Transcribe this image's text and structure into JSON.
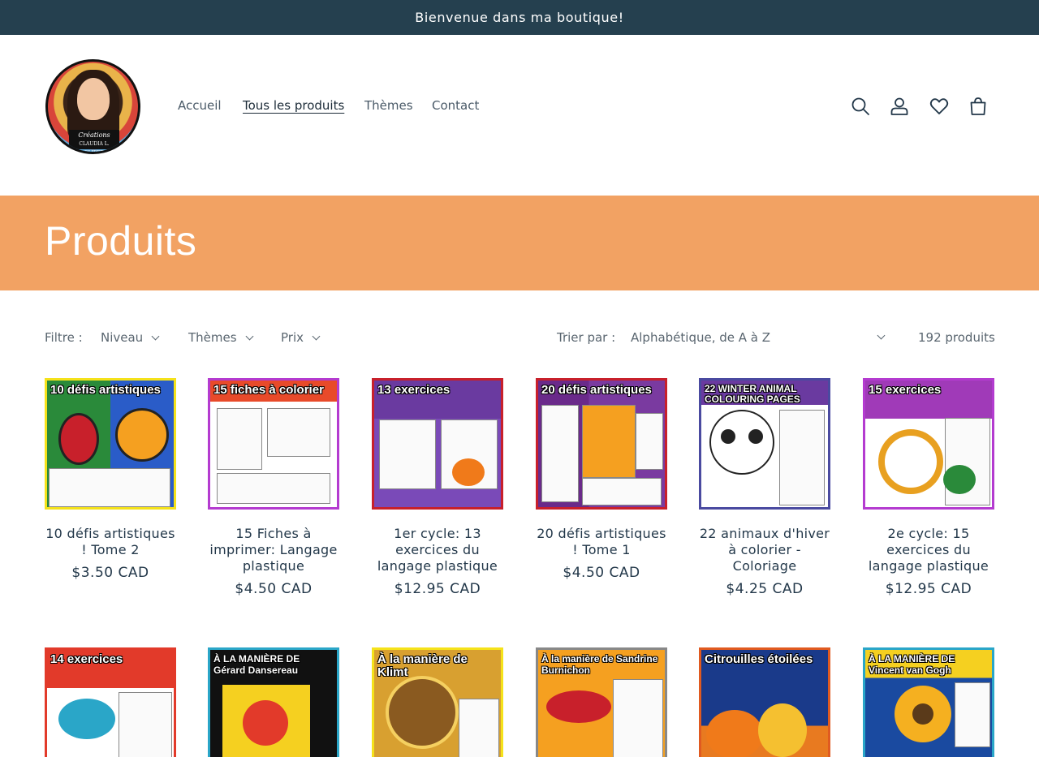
{
  "announcement": "Bienvenue dans ma boutique!",
  "logo": {
    "text_line1": "Créations",
    "text_line2": "CLAUDIA L. OLIBER"
  },
  "nav": [
    {
      "label": "Accueil",
      "active": false
    },
    {
      "label": "Tous les produits",
      "active": true
    },
    {
      "label": "Thèmes",
      "active": false
    },
    {
      "label": "Contact",
      "active": false
    }
  ],
  "header_icons": [
    "search-icon",
    "account-icon",
    "wishlist-heart-icon",
    "cart-icon"
  ],
  "colors": {
    "announcement_bg": "#25404f",
    "banner_bg": "#f2a263",
    "text": "#23384a"
  },
  "banner": {
    "title": "Produits"
  },
  "filters": {
    "label": "Filtre :",
    "items": [
      "Niveau",
      "Thèmes",
      "Prix"
    ],
    "sort_label": "Trier par :",
    "sort_value": "Alphabétique, de A à Z",
    "count": "192 produits"
  },
  "products": [
    {
      "name": "10 défis artistiques ! Tome 2",
      "price": "$3.50 CAD",
      "thumb_title": "10 défis artistiques",
      "border": "#f5e21a"
    },
    {
      "name": "15 Fiches à imprimer: Langage plastique",
      "price": "$4.50 CAD",
      "thumb_title": "15 fiches à colorier",
      "border": "#b43bd0"
    },
    {
      "name": "1er cycle: 13 exercices du langage plastique",
      "price": "$12.95 CAD",
      "thumb_title": "13 exercices",
      "border": "#c8202b"
    },
    {
      "name": "20 défis artistiques ! Tome 1",
      "price": "$4.50 CAD",
      "thumb_title": "20 défis artistiques",
      "border": "#c8202b"
    },
    {
      "name": "22 animaux d'hiver à colorier - Coloriage",
      "price": "$4.25 CAD",
      "thumb_title": "22 WINTER ANIMAL COLOURING PAGES",
      "border": "#4a4aa0"
    },
    {
      "name": "2e cycle: 15 exercices du langage plastique",
      "price": "$12.95 CAD",
      "thumb_title": "15 exercices",
      "border": "#b43bd0"
    },
    {
      "name": "",
      "price": "",
      "thumb_title": "14 exercices",
      "border": "#e23a2a"
    },
    {
      "name": "",
      "price": "",
      "thumb_title": "À LA MANIÈRE DE Gérard Dansereau",
      "border": "#2aa6c8"
    },
    {
      "name": "",
      "price": "",
      "thumb_title": "À la manière de Klimt",
      "border": "#f5e21a"
    },
    {
      "name": "",
      "price": "",
      "thumb_title": "À la manière de Sandrine Burnichon",
      "border": "#888888"
    },
    {
      "name": "",
      "price": "",
      "thumb_title": "Citrouilles étoilées",
      "border": "#e05a20"
    },
    {
      "name": "",
      "price": "",
      "thumb_title": "À LA MANIÈRE DE Vincent van Gogh",
      "border": "#2aa6c8"
    }
  ]
}
